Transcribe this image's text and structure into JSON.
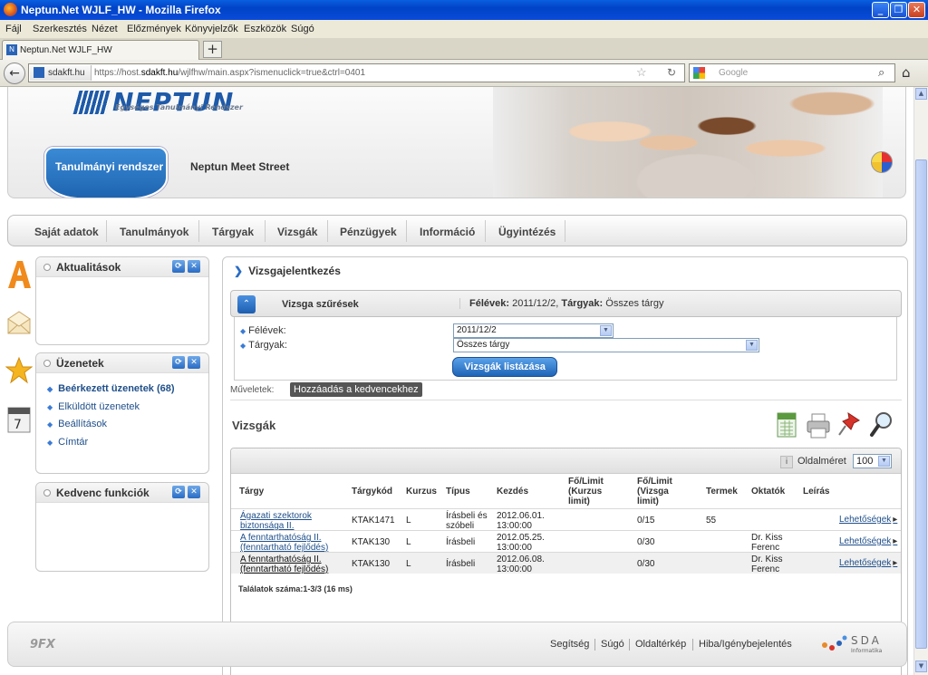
{
  "browser": {
    "window_title": "Neptun.Net WJLF_HW - Mozilla Firefox",
    "menu": [
      "Fájl",
      "Szerkesztés",
      "Nézet",
      "Előzmények",
      "Könyvjelzők",
      "Eszközök",
      "Súgó"
    ],
    "tab_title": "Neptun.Net WJLF_HW",
    "site_badge": "sdakft.hu",
    "url_prefix": "https://host.",
    "url_domain": "sdakft.hu",
    "url_rest": "/wjlfhw/main.aspx?ismenuclick=true&ctrl=0401",
    "search_placeholder": "Google"
  },
  "header": {
    "logo": "NEPTUN",
    "tagline": "Egységes Tanulmányi Rendszer",
    "active_tab": "Tanulmányi rendszer",
    "other_tab": "Neptun Meet Street"
  },
  "main_menu": [
    "Saját adatok",
    "Tanulmányok",
    "Tárgyak",
    "Vizsgák",
    "Pénzügyek",
    "Információ",
    "Ügyintézés"
  ],
  "side_panels": {
    "news": {
      "title": "Aktualitások"
    },
    "messages": {
      "title": "Üzenetek",
      "links": [
        "Beérkezett üzenetek (68)",
        "Elküldött üzenetek",
        "Beállítások",
        "Címtár"
      ]
    },
    "favorites": {
      "title": "Kedvenc funkciók"
    }
  },
  "content": {
    "title": "Vizsgajelentkezés",
    "filter": {
      "label": "Vizsga szűrések",
      "summary_sem_label": "Félévek:",
      "summary_sem_value": "2011/12/2",
      "summary_subj_label": "Tárgyak:",
      "summary_subj_value": "Összes tárgy",
      "sem_field_label": "Félévek:",
      "sem_value": "2011/12/2",
      "subj_field_label": "Tárgyak:",
      "subj_value": "Összes tárgy",
      "button": "Vizsgák listázása"
    },
    "ops_label": "Műveletek:",
    "fav_button": "Hozzáadás a kedvencekhez",
    "exams_title": "Vizsgák",
    "page_size_label": "Oldalméret",
    "page_size_value": "100",
    "columns": [
      "Tárgy",
      "Tárgykód",
      "Kurzus",
      "Típus",
      "Kezdés",
      "Fő/Limit (Kurzus limit)",
      "Fő/Limit (Vizsga limit)",
      "Termek",
      "Oktatók",
      "Leírás"
    ],
    "rows": [
      {
        "subject": "Ágazati szektorok biztonsága II.",
        "code": "KTAK1471",
        "course": "L",
        "type": "Írásbeli és szóbeli",
        "start": "2012.06.01. 13:00:00",
        "course_limit": "",
        "exam_limit": "0/15",
        "room": "55",
        "teacher": "",
        "more": "Lehetőségek"
      },
      {
        "subject": "A fenntarthatóság II. (fenntartható fejlődés)",
        "code": "KTAK130",
        "course": "L",
        "type": "Írásbeli",
        "start": "2012.05.25. 13:00:00",
        "course_limit": "",
        "exam_limit": "0/30",
        "room": "",
        "teacher": "Dr. Kiss Ferenc",
        "more": "Lehetőségek"
      },
      {
        "subject": "A fenntarthatóság II. (fenntartható fejlődés)",
        "code": "KTAK130",
        "course": "L",
        "type": "Írásbeli",
        "start": "2012.06.08. 13:00:00",
        "course_limit": "",
        "exam_limit": "0/30",
        "room": "",
        "teacher": "Dr. Kiss Ferenc",
        "more": "Lehetőségek"
      }
    ],
    "results": "Találatok száma:1-3/3 (16 ms)"
  },
  "footer": {
    "links": [
      "Segítség",
      "Súgó",
      "Oldaltérkép",
      "Hiba/Igénybejelentés"
    ],
    "sda": "SDA",
    "sda_sub": "Informatika",
    "logo_left": "9FX"
  }
}
